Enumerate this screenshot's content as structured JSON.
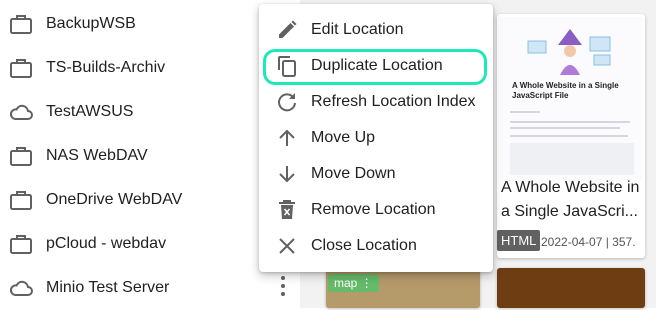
{
  "sidebar": {
    "items": [
      {
        "label": "BackupWSB",
        "icon": "briefcase-icon"
      },
      {
        "label": "TS-Builds-Archiv",
        "icon": "briefcase-icon"
      },
      {
        "label": "TestAWSUS",
        "icon": "cloud-icon"
      },
      {
        "label": "NAS WebDAV",
        "icon": "briefcase-icon"
      },
      {
        "label": "OneDrive WebDAV",
        "icon": "briefcase-icon"
      },
      {
        "label": "pCloud - webdav",
        "icon": "briefcase-icon"
      },
      {
        "label": "Minio Test Server",
        "icon": "cloud-icon"
      }
    ]
  },
  "context_menu": {
    "items": [
      {
        "label": "Edit Location",
        "icon": "pencil-icon"
      },
      {
        "label": "Duplicate Location",
        "icon": "copy-icon",
        "highlighted": true
      },
      {
        "label": "Refresh Location Index",
        "icon": "refresh-icon"
      },
      {
        "label": "Move Up",
        "icon": "arrow-up-icon"
      },
      {
        "label": "Move Down",
        "icon": "arrow-down-icon"
      },
      {
        "label": "Remove Location",
        "icon": "trash-icon"
      },
      {
        "label": "Close Location",
        "icon": "close-icon"
      }
    ],
    "highlight_color": "#1de9b6"
  },
  "gallery": {
    "card": {
      "thumb_title": "A Whole Website in a Single JavaScript File",
      "title": "A Whole Website in a Single JavaScri...",
      "type_tag": "HTML",
      "meta": "2022-04-07 | 357."
    },
    "map_badge": "map"
  }
}
